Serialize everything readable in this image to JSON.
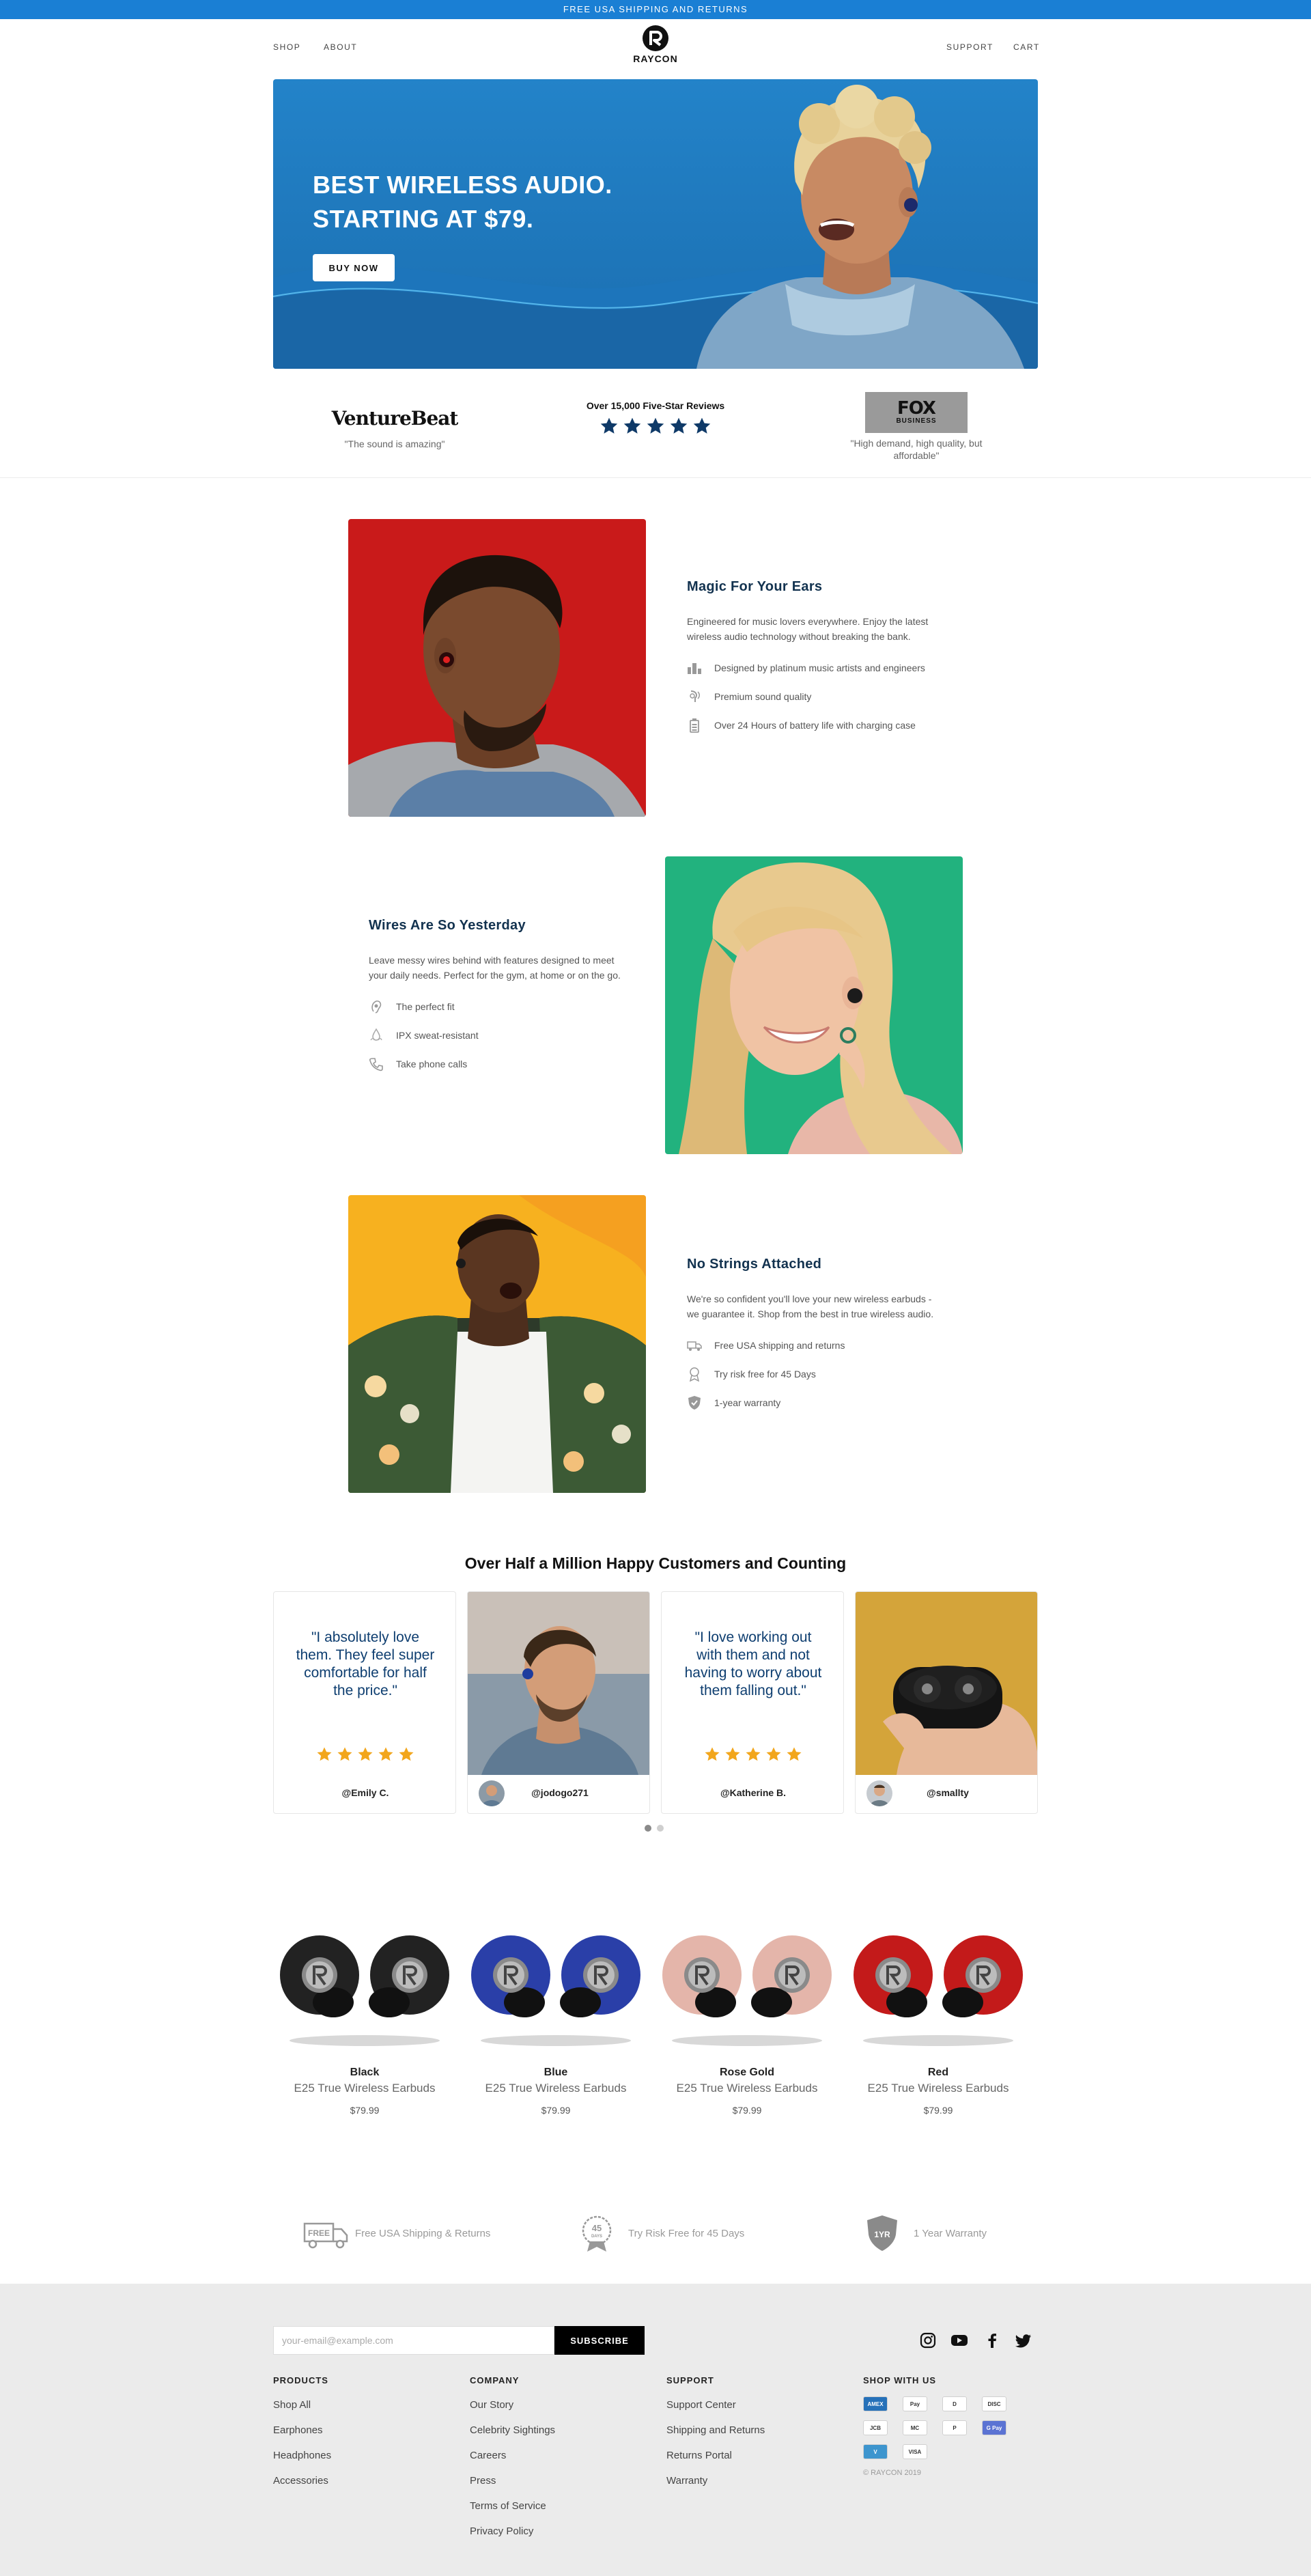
{
  "announcement": "FREE USA SHIPPING AND RETURNS",
  "header": {
    "nav_left": [
      "SHOP",
      "ABOUT"
    ],
    "nav_right": [
      "SUPPORT",
      "CART"
    ],
    "logo_text": "RAYCON"
  },
  "hero": {
    "title_line1": "BEST WIRELESS AUDIO.",
    "title_line2": "STARTING AT $79.",
    "button": "BUY NOW"
  },
  "press": {
    "venturebeat_logo": "VentureBeat",
    "venturebeat_quote": "\"The sound is amazing\"",
    "reviews_title": "Over 15,000 Five-Star Reviews",
    "review_stars": 5,
    "fox_logo": "FOX",
    "fox_logo_sub": "BUSINESS",
    "fox_quote": "\"High demand, high quality, but affordable\""
  },
  "features": [
    {
      "title": "Magic For Your Ears",
      "description": "Engineered for music lovers everywhere. Enjoy the latest wireless audio technology without breaking the bank.",
      "items": [
        {
          "icon": "music-artists-icon",
          "text": "Designed by platinum music artists and engineers"
        },
        {
          "icon": "sound-quality-icon",
          "text": "Premium sound quality"
        },
        {
          "icon": "battery-icon",
          "text": "Over 24 Hours of battery life with charging case"
        }
      ]
    },
    {
      "title": "Wires Are So Yesterday",
      "description": "Leave messy wires behind with features designed to meet your daily needs. Perfect for the gym, at home or on the go.",
      "items": [
        {
          "icon": "ear-fit-icon",
          "text": "The perfect fit"
        },
        {
          "icon": "sweat-resistant-icon",
          "text": "IPX sweat-resistant"
        },
        {
          "icon": "phone-icon",
          "text": "Take phone calls"
        }
      ]
    },
    {
      "title": "No Strings Attached",
      "description": "We're so confident you'll love your new wireless earbuds - we guarantee it. Shop from the best in true wireless audio.",
      "items": [
        {
          "icon": "shipping-truck-icon",
          "text": "Free USA shipping and returns"
        },
        {
          "icon": "trial-icon",
          "text": "Try risk free for 45 Days"
        },
        {
          "icon": "warranty-shield-icon",
          "text": "1-year warranty"
        }
      ]
    }
  ],
  "testimonials": {
    "heading": "Over Half a Million Happy Customers and Counting",
    "cards": [
      {
        "type": "quote",
        "quote": "\"I absolutely love them. They feel super comfortable for half the price.\"",
        "stars": 5,
        "handle": "@Emily C."
      },
      {
        "type": "photo",
        "handle": "@jodogo271"
      },
      {
        "type": "quote",
        "quote": "\"I love working out with them and not having to worry about them falling out.\"",
        "stars": 5,
        "handle": "@Katherine B."
      },
      {
        "type": "photo",
        "handle": "@smallty"
      }
    ],
    "pages": 2,
    "active_page": 1
  },
  "products": [
    {
      "color_name": "Black",
      "name": "E25 True Wireless Earbuds",
      "price": "$79.99",
      "color": "#222222"
    },
    {
      "color_name": "Blue",
      "name": "E25 True Wireless Earbuds",
      "price": "$79.99",
      "color": "#2a3fa8"
    },
    {
      "color_name": "Rose Gold",
      "name": "E25 True Wireless Earbuds",
      "price": "$79.99",
      "color": "#e4b5aa"
    },
    {
      "color_name": "Red",
      "name": "E25 True Wireless Earbuds",
      "price": "$79.99",
      "color": "#c31a1a"
    }
  ],
  "guarantees": [
    {
      "icon": "free-shipping-truck-icon",
      "badge": "FREE",
      "text": "Free USA Shipping & Returns"
    },
    {
      "icon": "45-days-badge-icon",
      "badge": "45",
      "badge_sub": "DAYS",
      "text": "Try Risk Free for 45 Days"
    },
    {
      "icon": "1-year-shield-icon",
      "badge": "1YR",
      "text": "1 Year Warranty"
    }
  ],
  "footer": {
    "email_placeholder": "your-email@example.com",
    "subscribe": "SUBSCRIBE",
    "social": [
      "instagram-icon",
      "youtube-icon",
      "facebook-icon",
      "twitter-icon"
    ],
    "columns": [
      {
        "title": "PRODUCTS",
        "links": [
          "Shop All",
          "Earphones",
          "Headphones",
          "Accessories"
        ]
      },
      {
        "title": "COMPANY",
        "links": [
          "Our Story",
          "Celebrity Sightings",
          "Careers",
          "Press",
          "Terms of Service",
          "Privacy Policy"
        ]
      },
      {
        "title": "SUPPORT",
        "links": [
          "Support Center",
          "Shipping and Returns",
          "Returns Portal",
          "Warranty"
        ]
      }
    ],
    "shop_with_us_title": "SHOP WITH US",
    "payments": [
      {
        "name": "AMEX",
        "color": "#2671b9"
      },
      {
        "name": "Pay",
        "color": "#ffffff"
      },
      {
        "name": "D",
        "color": "#ffffff"
      },
      {
        "name": "DISC",
        "color": "#ffffff"
      },
      {
        "name": "JCB",
        "color": "#ffffff"
      },
      {
        "name": "MC",
        "color": "#ffffff"
      },
      {
        "name": "P",
        "color": "#ffffff"
      },
      {
        "name": "G Pay",
        "color": "#5b73d3"
      },
      {
        "name": "V",
        "color": "#3d95ce"
      },
      {
        "name": "VISA",
        "color": "#ffffff"
      }
    ],
    "copyright": "© RAYCON 2019"
  }
}
